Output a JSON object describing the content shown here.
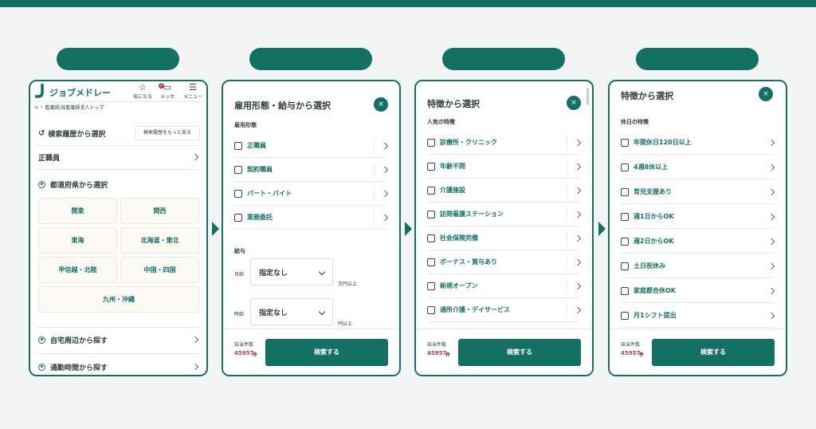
{
  "colors": {
    "accent": "#137164",
    "count": "#c23a4a",
    "background": "#f3f5f4"
  },
  "screen1": {
    "logo_text": "ジョブメドレー",
    "header_buttons": [
      {
        "icon": "star-icon",
        "label": "気になる"
      },
      {
        "icon": "message-icon",
        "label": "メッセ",
        "badge": "2"
      },
      {
        "icon": "menu-icon",
        "label": "メニュー"
      }
    ],
    "breadcrumb": "看護師/准看護師求人トップ",
    "history_title": "検索履歴から選択",
    "history_button": "検索履歴をもっと見る",
    "history_item": "正職員",
    "pref_title": "都道府県から選択",
    "prefectures": [
      "関東",
      "関西",
      "東海",
      "北海道・東北",
      "甲信越・北陸",
      "中国・四国",
      "九州・沖縄"
    ],
    "nearby": "自宅周辺から探す",
    "commute": "通勤時間から探す"
  },
  "screen2": {
    "title": "雇用形態・給与から選択",
    "employment_heading": "雇用形態",
    "employment_options": [
      "正職員",
      "契約職員",
      "パート・バイト",
      "業務委託"
    ],
    "salary_heading": "給与",
    "monthly_label": "月給",
    "monthly_value": "指定なし",
    "monthly_unit": "万円以上",
    "hourly_label": "時給",
    "hourly_value": "指定なし",
    "hourly_unit": "円以上"
  },
  "screen3": {
    "title": "特徴から選択",
    "heading": "人気の特徴",
    "options": [
      "診療所・クリニック",
      "年齢不問",
      "介護施設",
      "訪問看護ステーション",
      "社会保険完備",
      "ボーナス・賞与あり",
      "新規オープン",
      "通所介護・デイサービス"
    ]
  },
  "screen4": {
    "title": "特徴から選択",
    "heading": "休日の特徴",
    "options": [
      "年間休日120日以上",
      "4週8休以上",
      "育児支援あり",
      "週1日からOK",
      "週2日からOK",
      "土日祝休み",
      "家庭都合休OK",
      "月1シフト提出"
    ]
  },
  "footer": {
    "count_label": "該当件数",
    "count": "45957",
    "count_unit": "件",
    "search_button": "検索する",
    "close": "×"
  }
}
